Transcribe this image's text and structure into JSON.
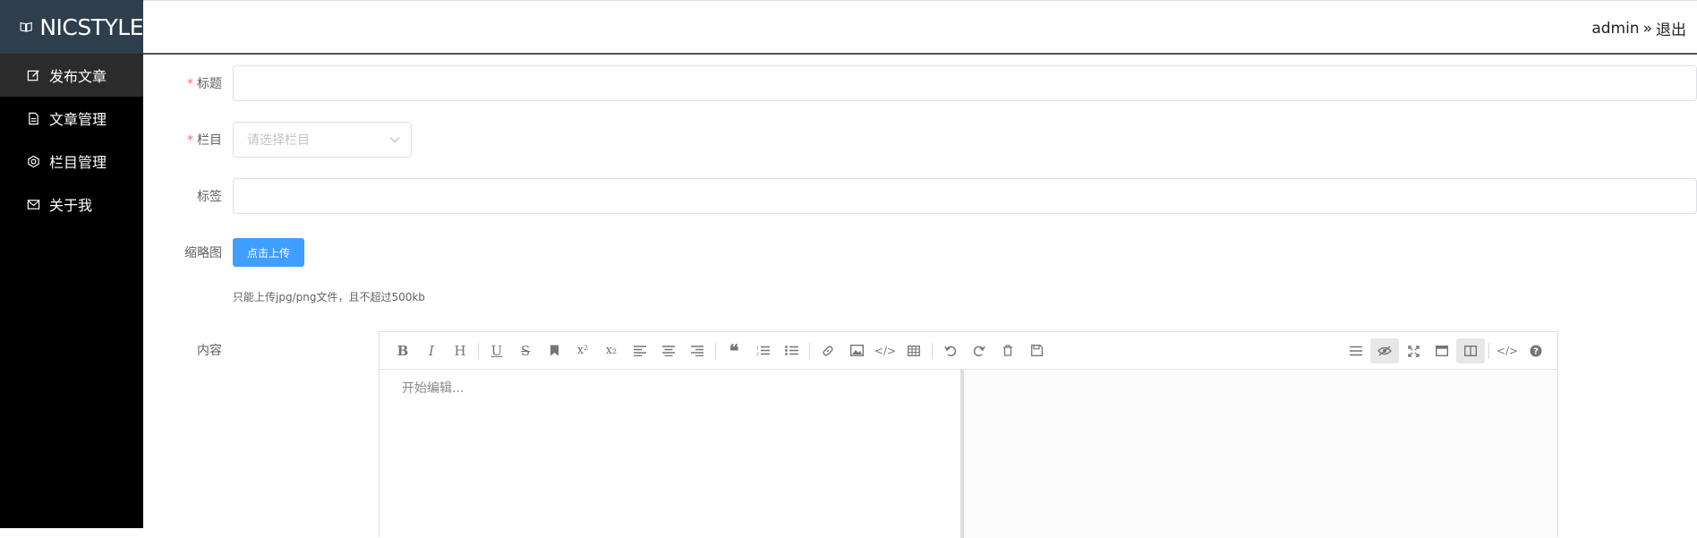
{
  "brand": {
    "name": "NICSTYLE"
  },
  "sidebar": {
    "items": [
      {
        "label": "发布文章",
        "icon": "edit-icon",
        "active": true
      },
      {
        "label": "文章管理",
        "icon": "document-icon",
        "active": false
      },
      {
        "label": "栏目管理",
        "icon": "settings-icon",
        "active": false
      },
      {
        "label": "关于我",
        "icon": "mail-icon",
        "active": false
      }
    ]
  },
  "header": {
    "username": "admin",
    "logout_label": "退出"
  },
  "form": {
    "title_label": "标题",
    "title_value": "",
    "category_label": "栏目",
    "category_placeholder": "请选择栏目",
    "tags_label": "标签",
    "tags_value": "",
    "thumbnail_label": "缩略图",
    "upload_label": "点击上传",
    "upload_tip": "只能上传jpg/png文件，且不超过500kb",
    "content_label": "内容",
    "editor_placeholder": "开始编辑..."
  },
  "colors": {
    "primary": "#409eff",
    "sidebar_bg": "#000000",
    "brand_bg": "#2f3e4d",
    "required": "#f56c6c"
  }
}
